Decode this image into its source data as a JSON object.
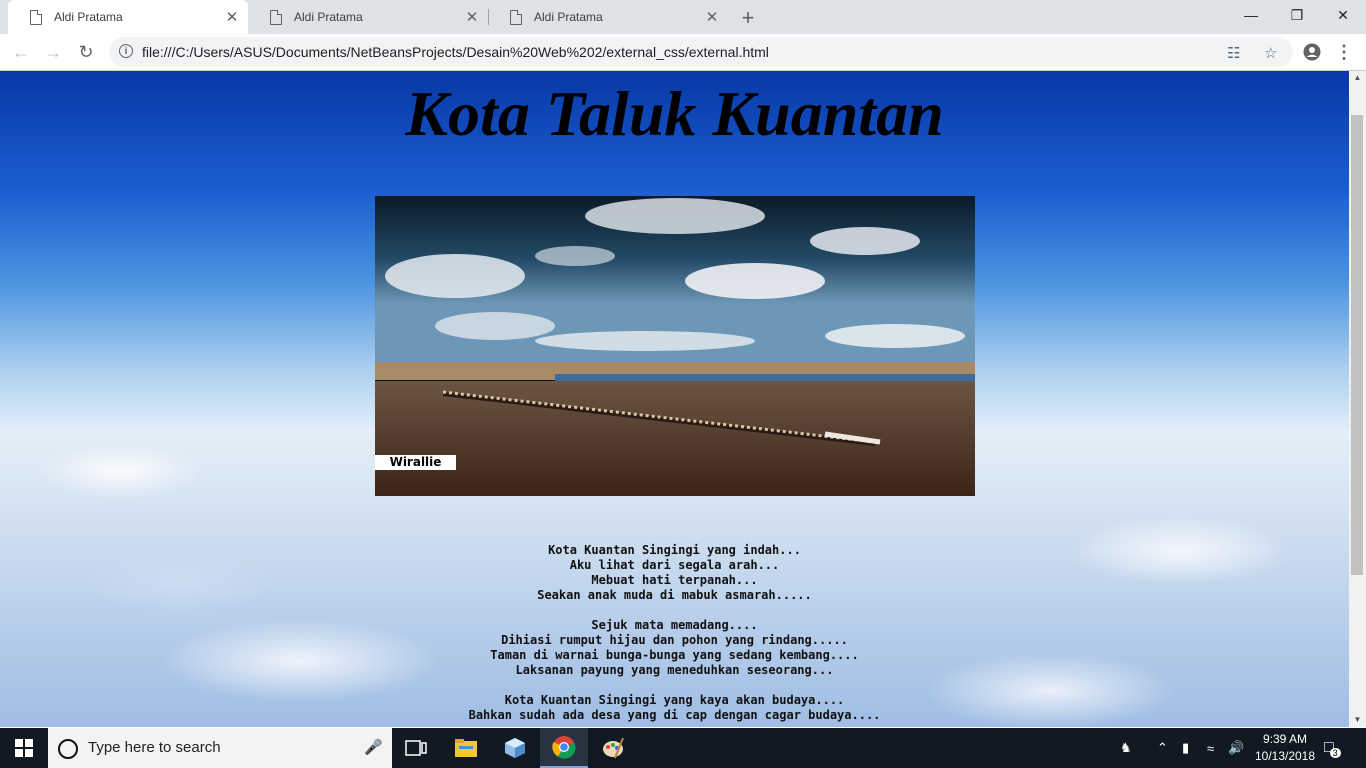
{
  "browser": {
    "tabs": [
      {
        "title": "Aldi Pratama",
        "close": "✕"
      },
      {
        "title": "Aldi Pratama",
        "close": "✕"
      },
      {
        "title": "Aldi Pratama",
        "close": "✕"
      }
    ],
    "new_tab": "+",
    "window_controls": {
      "minimize": "—",
      "restore": "❐",
      "close": "✕"
    },
    "url": "file:///C:/Users/ASUS/Documents/NetBeansProjects/Desain%20Web%202/external_css/external.html"
  },
  "page": {
    "heading": "Kota Taluk Kuantan",
    "photo_label": "Wirallie",
    "poem": [
      "Kota Kuantan Singingi yang indah...",
      "Aku lihat dari segala arah...",
      "Mebuat hati terpanah...",
      "Seakan anak muda di mabuk asmarah.....",
      "",
      "Sejuk mata memadang....",
      "Dihiasi rumput hijau dan pohon yang rindang.....",
      "Taman di warnai bunga-bunga yang sedang kembang....",
      "Laksanan payung yang meneduhkan seseorang...",
      "",
      "Kota Kuantan Singingi yang kaya akan budaya....",
      "Bahkan sudah ada desa yang di cap dengan cagar budaya...."
    ]
  },
  "taskbar": {
    "search_placeholder": "Type here to search",
    "time": "9:39 AM",
    "date": "10/13/2018",
    "notification_count": "3"
  }
}
